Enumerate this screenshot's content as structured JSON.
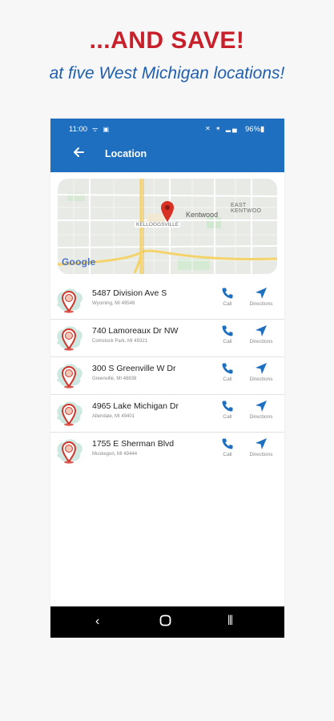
{
  "promo": {
    "headline": "...AND SAVE!",
    "subline": "at five West Michigan locations!"
  },
  "status_bar": {
    "time": "11:00",
    "left_icons": "ᯤ ▣",
    "right_icons": "✕ ✶ ▂▄",
    "battery": "96%▮"
  },
  "app_bar": {
    "back_icon": "arrow-left-icon",
    "title": "Location",
    "color": "#1e6fc0"
  },
  "map": {
    "labels": {
      "kentwood": "Kentwood",
      "east_kentwood": "EAST KENTWOO",
      "kelloggsville": "KELLOGGSVILLE"
    },
    "logo": "Google",
    "pin_color": "#d93025"
  },
  "locations": [
    {
      "address": "5487 Division Ave S",
      "city": "Wyoming, MI 49548",
      "call_label": "Call",
      "directions_label": "Directions"
    },
    {
      "address": "740 Lamoreaux Dr NW",
      "city": "Comstock Park, MI 49321",
      "call_label": "Call",
      "directions_label": "Directions"
    },
    {
      "address": "300 S Greenville W Dr",
      "city": "Greenville, MI 48838",
      "call_label": "Call",
      "directions_label": "Directions"
    },
    {
      "address": "4965 Lake Michigan Dr",
      "city": "Allendale, MI 49401",
      "call_label": "Call",
      "directions_label": "Directions"
    },
    {
      "address": "1755 E Sherman Blvd",
      "city": "Muskegon, MI 49444",
      "call_label": "Call",
      "directions_label": "Directions"
    }
  ],
  "nav_bar": {
    "back_glyph": "‹",
    "recent_glyph": "⦀"
  },
  "colors": {
    "headline": "#c8202a",
    "subline": "#1f5fae",
    "action_icon": "#1e6fc0"
  }
}
